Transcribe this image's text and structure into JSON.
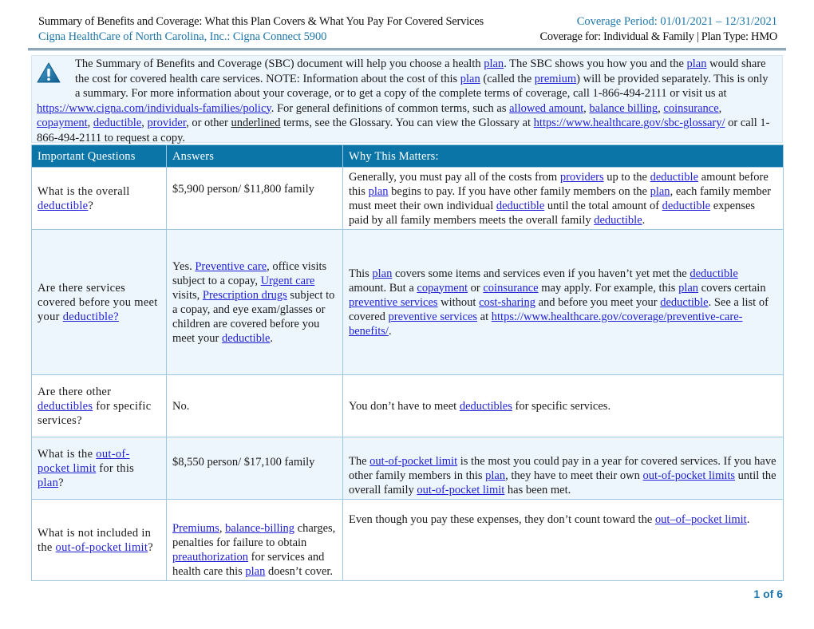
{
  "header": {
    "title": "Summary of Benefits and Coverage: What this Plan Covers & What You Pay For Covered Services",
    "plan_name": "Cigna HealthCare of North Carolina, Inc.:  Cigna Connect 5900",
    "coverage_period": "Coverage Period: 01/01/2021 – 12/31/2021",
    "coverage_for": "Coverage for:  Individual & Family | Plan Type:  HMO"
  },
  "notice": {
    "icon": "warning-triangle-icon",
    "p1_a": "The Summary of Benefits and Coverage (SBC) document will help you choose a health ",
    "p1_plan1": "plan",
    "p1_b": ". The SBC shows you how you and the ",
    "p1_plan2": "plan",
    "p1_c": " would share the cost for covered health care services. NOTE: Information about the cost of this ",
    "p1_plan3": "plan",
    "p1_d": " (called the ",
    "p1_premium": "premium",
    "p1_e": ") will be provided separately. This is only a summary. For more information about your coverage, or to get a copy of the complete terms of coverage, call 1-866-494-2111 or visit us at ",
    "policy_url": "https://www.cigna.com/individuals-families/policy",
    "p2_a": ".  For general definitions of common terms, such as ",
    "term_allowed": "allowed amount",
    "term_balance": "balance billing",
    "term_coins": "coinsurance",
    "term_copay": "copayment",
    "term_deductible": "deductible",
    "term_provider": "provider",
    "p2_b": ", or other ",
    "underlined": "underlined",
    "p2_c": " terms, see the Glossary.  You can view the Glossary at ",
    "glossary_url": "https://www.healthcare.gov/sbc-glossary/",
    "p2_d": " or call 1-866-494-2111 to request a copy."
  },
  "table": {
    "headers": [
      "Important Questions",
      "Answers",
      "Why This Matters:"
    ],
    "rows": [
      {
        "q_a": "What is the overall ",
        "q_link": "deductible",
        "q_b": "?",
        "answer": "$5,900 person/ $11,800 family",
        "why": {
          "a": "Generally, you must pay all of the costs from ",
          "l1": "providers",
          "b": " up to the ",
          "l2": "deductible",
          "c": " amount before this ",
          "l3": "plan",
          "d": " begins to pay. If you have other family members on the ",
          "l4": "plan",
          "e": ", each family member must meet their own individual ",
          "l5": "deductible",
          "f": " until the total amount of ",
          "l6": "deductible",
          "g": " expenses paid by all family members meets the overall family ",
          "l7": "deductible",
          "h": "."
        }
      },
      {
        "q_a": "Are there services covered before you meet your ",
        "q_link": "deductible?",
        "answer": {
          "a": "Yes. ",
          "l1": "Preventive care",
          "b": ", office visits subject to a copay, ",
          "l2": "Urgent care",
          "c": " visits, ",
          "l3": "Prescription drugs",
          "d": " subject to a copay, and eye exam/glasses or children are covered before you meet your ",
          "l4": "deductible",
          "e": "."
        },
        "why": {
          "a": "This ",
          "l1": "plan",
          "b": " covers some items and services even if you haven’t yet met the ",
          "l2": "deductible",
          "c": " amount. But a ",
          "l3": "copayment",
          "d": " or ",
          "l4": "coinsurance",
          "e": " may apply. For example, this ",
          "l5": "plan",
          "f": " covers certain ",
          "l6": "preventive services",
          "g": " without ",
          "l7": "cost-sharing",
          "h": " and before you meet your ",
          "l8": "deductible",
          "i": ". See a list of covered ",
          "l9": "preventive services",
          "j": " at ",
          "l10": "https://www.healthcare.gov/coverage/preventive-care-benefits/",
          "k": "."
        }
      },
      {
        "q_a": "Are there other ",
        "q_link": "deductibles",
        "q_b": " for specific services?",
        "answer": "No.",
        "why": {
          "a": "You don’t have to meet ",
          "l1": "deductibles",
          "b": " for specific services."
        }
      },
      {
        "q_a": "What is the ",
        "q_link": "out-of-pocket limit",
        "q_b": " for this ",
        "q_link2": "plan",
        "q_c": "?",
        "answer": "$8,550 person/ $17,100 family",
        "why": {
          "a": "The ",
          "l1": "out-of-pocket limit",
          "b": " is the most you could pay in a year for covered services. If you have other family members in this ",
          "l2": "plan",
          "c": ", they have to meet their own ",
          "l3": "out-of-pocket limits",
          "d": " until the overall family ",
          "l4": "out-of-pocket limit",
          "e": " has been met."
        }
      },
      {
        "q_a": "What is not included in the ",
        "q_link": "out-of-pocket limit",
        "q_b": "?",
        "answer": {
          "l1": "Premiums",
          "a": ", ",
          "l2": "balance-billing",
          "b": " charges, penalties for failure to obtain ",
          "l3": "preauthorization",
          "c": " for services and health care this ",
          "l4": "plan",
          "d": " doesn’t cover."
        },
        "why": {
          "a": "Even though you pay these expenses, they don’t count toward the ",
          "l1": "out–of–pocket limit",
          "b": "."
        }
      }
    ]
  },
  "footer": {
    "page_number": "1 of 6"
  }
}
